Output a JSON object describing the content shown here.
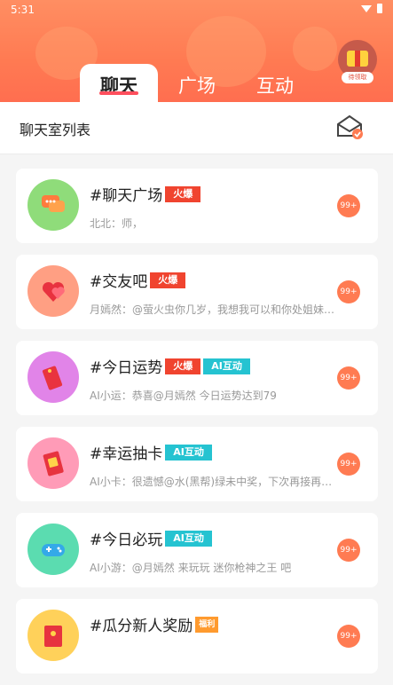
{
  "status_bar": {
    "time": "5:31"
  },
  "tabs": [
    {
      "label": "聊天",
      "active": true
    },
    {
      "label": "广场",
      "active": false
    },
    {
      "label": "互动",
      "active": false
    }
  ],
  "gift": {
    "label": "待领取"
  },
  "subheader": {
    "title": "聊天室列表"
  },
  "rooms": [
    {
      "title": "#聊天广场",
      "tags": [
        "火爆"
      ],
      "message": "北北：师，",
      "badge": "99+",
      "avatar_color": "#8fdc7a",
      "icon": "chat-bubbles-icon"
    },
    {
      "title": "#交友吧",
      "tags": [
        "火爆"
      ],
      "message": "月嫣然：@萤火虫你几岁，我想我可以和你处姐妹…",
      "badge": "99+",
      "avatar_color": "#ff9f83",
      "icon": "hearts-icon"
    },
    {
      "title": "#今日运势",
      "tags": [
        "火爆",
        "AI互动"
      ],
      "message": "AI小运：恭喜@月嫣然 今日运势达到79",
      "badge": "99+",
      "avatar_color": "#e184e8",
      "icon": "fortune-tag-icon"
    },
    {
      "title": "#幸运抽卡",
      "tags": [
        "AI互动"
      ],
      "message": "AI小卡：很遗憾@水(黑帮)绿未中奖，下次再接再…",
      "badge": "99+",
      "avatar_color": "#ff9bb7",
      "icon": "lucky-card-icon"
    },
    {
      "title": "#今日必玩",
      "tags": [
        "AI互动"
      ],
      "message": "AI小游：@月嫣然 来玩玩 迷你枪神之王 吧",
      "badge": "99+",
      "avatar_color": "#5bdcb0",
      "icon": "gamepad-icon"
    },
    {
      "title": "#瓜分新人奖励",
      "tags": [
        "福利"
      ],
      "message": "",
      "badge": "99+",
      "avatar_color": "#ffd15a",
      "icon": "red-envelope-icon"
    }
  ],
  "colors": {
    "header_orange": "#ff7a52",
    "hot_tag": "#f0442f",
    "ai_tag": "#25c3d1",
    "badge": "#ff7b52"
  }
}
